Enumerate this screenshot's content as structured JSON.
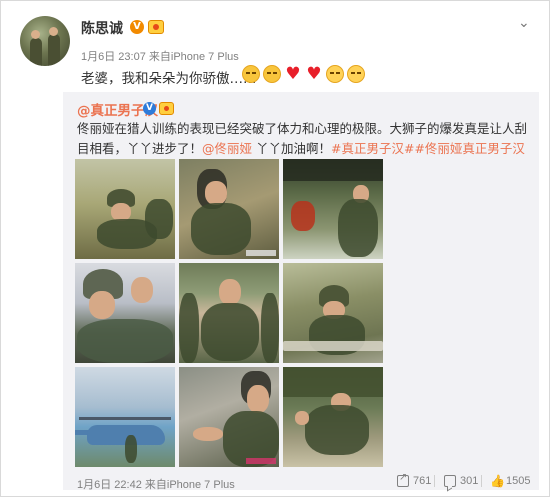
{
  "post": {
    "author": "陈思诚",
    "verified_badge": "V",
    "meta": "1月6日 23:07 来自iPhone 7 Plus",
    "text": "老婆，我和朵朵为你骄傲……",
    "emojis": [
      "smiling-face",
      "smiling-face",
      "red-heart",
      "red-heart",
      "grinning-face",
      "grinning-face"
    ]
  },
  "repost": {
    "author": "@真正男子汉",
    "verified_badge": "V",
    "text_part1": "佟丽娅在猎人训练的表现已经突破了体力和心理的极限。大狮子的爆发真是让人刮目相看，丫丫进步了！",
    "mention": "@佟丽娅",
    "text_part2": " 丫丫加油啊！",
    "hashtags": "#真正男子汉##佟丽娅真正男子汉#",
    "photos_count": 9,
    "meta": "1月6日 22:42 来自iPhone 7 Plus",
    "stats": {
      "shares": "761",
      "comments": "301",
      "likes": "1505"
    }
  },
  "colors": {
    "link": "#eb7350",
    "repost_bg": "#f2f2f5",
    "muted": "#808080"
  }
}
